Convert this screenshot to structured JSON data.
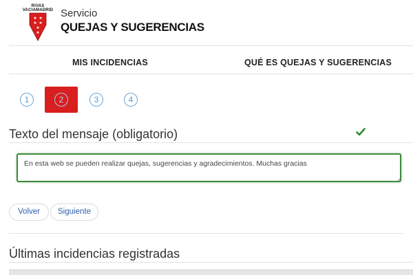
{
  "header": {
    "logo_text_1": "RIVAS",
    "logo_text_2": "VACIAMADRID",
    "service_title": "Servicio",
    "service_name": "QUEJAS Y SUGERENCIAS"
  },
  "nav": {
    "tabs": [
      {
        "label": "MIS INCIDENCIAS"
      },
      {
        "label": "QUÉ ES QUEJAS Y SUGERENCIAS"
      }
    ]
  },
  "steps": {
    "items": [
      "1",
      "2",
      "3",
      "4"
    ],
    "active": "2"
  },
  "form": {
    "message_label": "Texto del mensaje (obligatorio)",
    "message_value": "En esta web se pueden realizar quejas, sugerencias y agradecimientos. Muchas gracias"
  },
  "buttons": {
    "back_label": "Volver",
    "next_label": "Siguiente"
  },
  "recent": {
    "title": "Últimas incidencias registradas"
  },
  "colors": {
    "brand_red": "#d81e1e",
    "step_blue": "#5b98cf",
    "valid_green": "#3c8a3c",
    "link_blue": "#2d5ea8"
  }
}
